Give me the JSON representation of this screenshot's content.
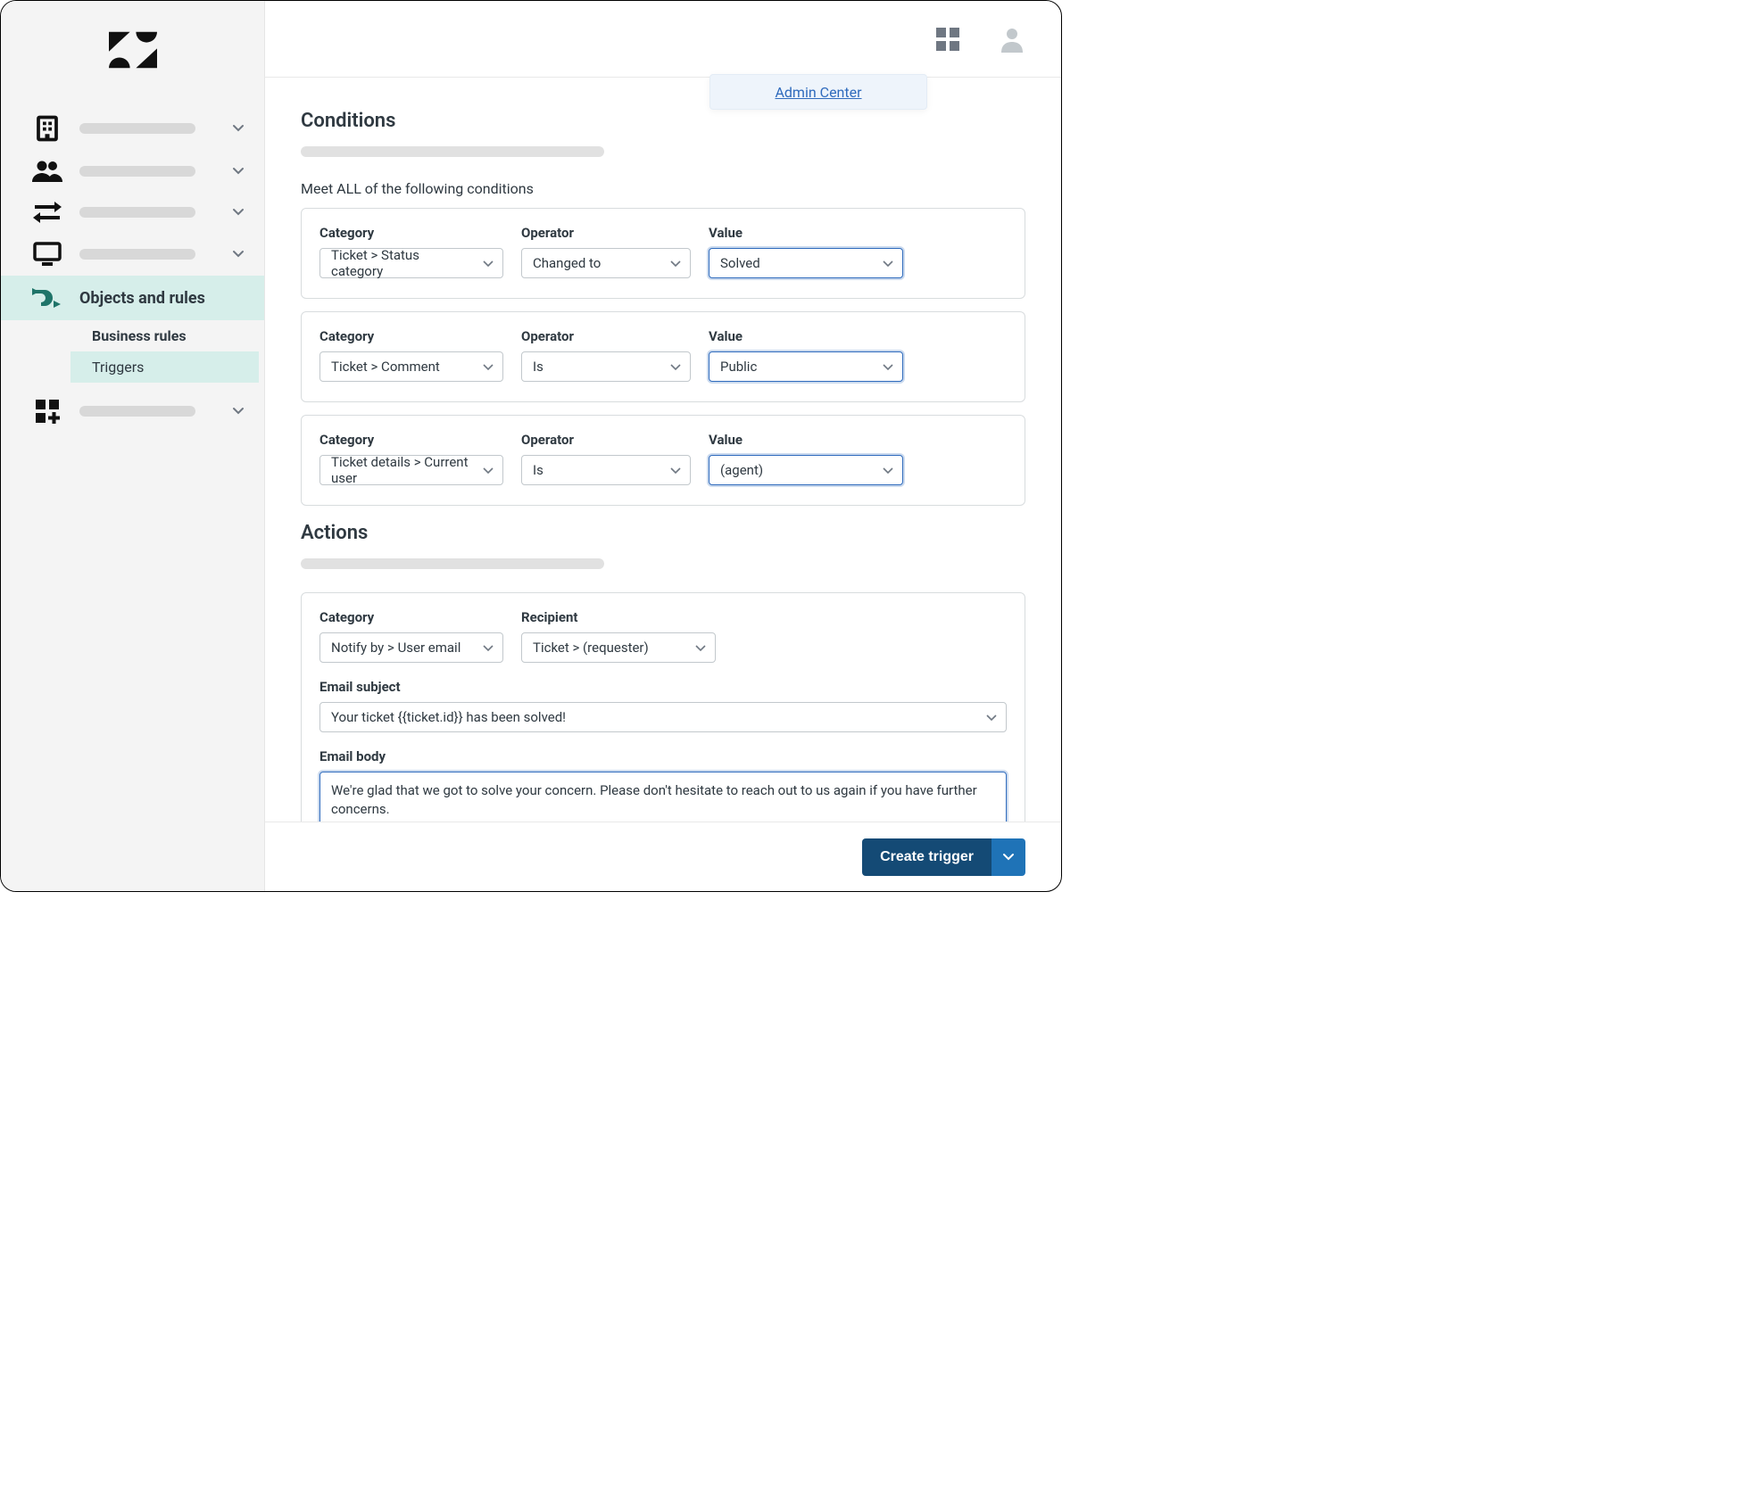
{
  "popover": {
    "label": "Admin Center"
  },
  "sidebar": {
    "active": {
      "label": "Objects and rules"
    },
    "sub": {
      "section": "Business rules",
      "selected": "Triggers"
    }
  },
  "sections": {
    "conditions_title": "Conditions",
    "conditions_meet_all": "Meet ALL of the following conditions",
    "actions_title": "Actions"
  },
  "labels": {
    "category": "Category",
    "operator": "Operator",
    "value": "Value",
    "recipient": "Recipient",
    "email_subject": "Email subject",
    "email_body": "Email body"
  },
  "conditions": [
    {
      "category": "Ticket > Status category",
      "operator": "Changed to",
      "value": "Solved"
    },
    {
      "category": "Ticket > Comment",
      "operator": "Is",
      "value": "Public"
    },
    {
      "category": "Ticket details > Current user",
      "operator": "Is",
      "value": "(agent)"
    }
  ],
  "actions": {
    "category": "Notify by > User email",
    "recipient": "Ticket > (requester)",
    "email_subject": "Your ticket {{ticket.id}} has been solved!",
    "email_body": "We're glad that we got to solve your concern. Please don't hesitate to reach out to us again if you have further concerns."
  },
  "footer": {
    "create_label": "Create trigger"
  }
}
